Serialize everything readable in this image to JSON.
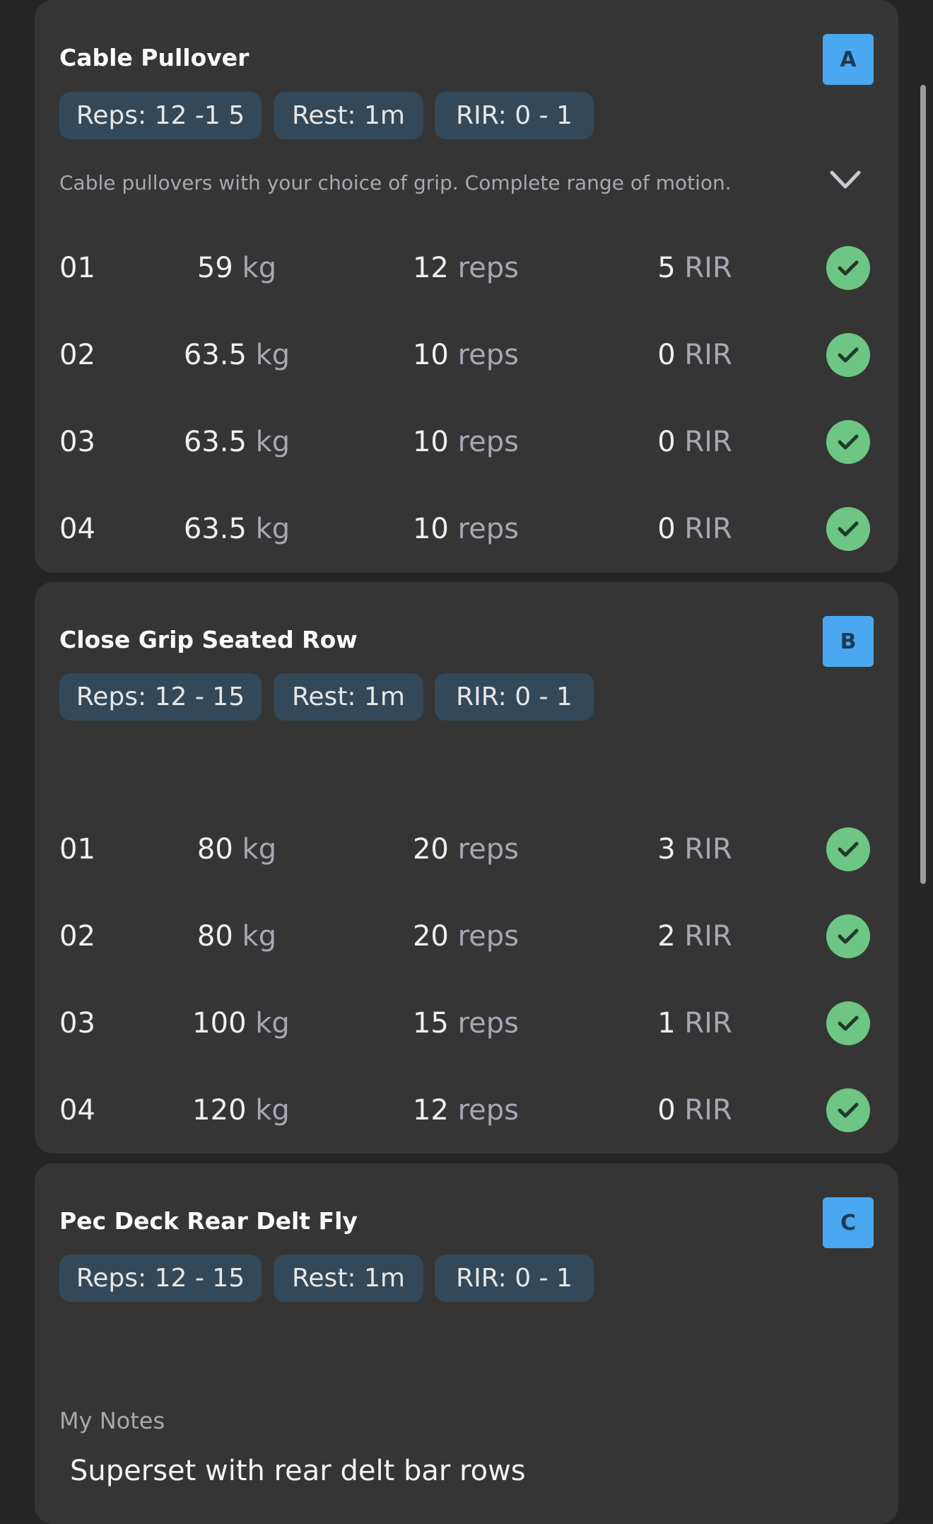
{
  "exercises": [
    {
      "title": "Cable Pullover",
      "badge": "A",
      "chips": [
        "Reps: 12 -1 5",
        "Rest: 1m",
        "RIR: 0 - 1"
      ],
      "description": "Cable pullovers with your choice of grip. Complete range of motion.",
      "sets": [
        {
          "num": "01",
          "weight": "59",
          "reps": "12",
          "rir": "5"
        },
        {
          "num": "02",
          "weight": "63.5",
          "reps": "10",
          "rir": "0"
        },
        {
          "num": "03",
          "weight": "63.5",
          "reps": "10",
          "rir": "0"
        },
        {
          "num": "04",
          "weight": "63.5",
          "reps": "10",
          "rir": "0"
        }
      ]
    },
    {
      "title": "Close Grip Seated Row",
      "badge": "B",
      "chips": [
        "Reps: 12 - 15",
        "Rest: 1m",
        "RIR: 0 - 1"
      ],
      "sets": [
        {
          "num": "01",
          "weight": "80",
          "reps": "20",
          "rir": "3"
        },
        {
          "num": "02",
          "weight": "80",
          "reps": "20",
          "rir": "2"
        },
        {
          "num": "03",
          "weight": "100",
          "reps": "15",
          "rir": "1"
        },
        {
          "num": "04",
          "weight": "120",
          "reps": "12",
          "rir": "0"
        }
      ]
    },
    {
      "title": "Pec Deck Rear Delt Fly",
      "badge": "C",
      "chips": [
        "Reps: 12 - 15",
        "Rest: 1m",
        "RIR: 0 - 1"
      ],
      "notes_label": "My Notes",
      "notes": "Superset with rear delt bar rows"
    }
  ],
  "units": {
    "weight": "kg",
    "reps": "reps",
    "rir": "RIR"
  },
  "colors": {
    "background": "#252525",
    "card": "#353535",
    "chip": "#33495a",
    "badge": "#4aa8f0",
    "check": "#6dc683",
    "muted": "#a7a7b4"
  },
  "icons": {
    "expand": "chevron-down-icon",
    "complete": "check-circle-icon"
  }
}
